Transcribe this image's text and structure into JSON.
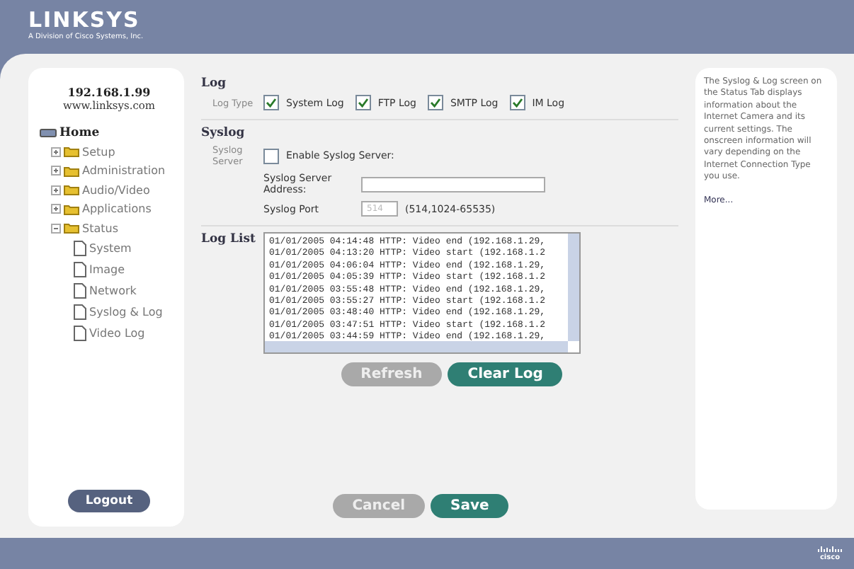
{
  "header": {
    "logo": "LINKSYS",
    "tagline": "A Division of Cisco Systems, Inc."
  },
  "sidebar": {
    "address": "192.168.1.99",
    "site": "www.linksys.com",
    "tree": [
      {
        "label": "Home",
        "children": [
          {
            "label": "Setup",
            "expanded": false
          },
          {
            "label": "Administration",
            "expanded": false
          },
          {
            "label": "Audio/Video",
            "expanded": false
          },
          {
            "label": "Applications",
            "expanded": false
          },
          {
            "label": "Status",
            "expanded": true,
            "children": [
              {
                "label": "System"
              },
              {
                "label": "Image"
              },
              {
                "label": "Network"
              },
              {
                "label": "Syslog & Log"
              },
              {
                "label": "Video Log"
              }
            ]
          }
        ]
      }
    ],
    "logout": "Logout"
  },
  "log": {
    "heading": "Log",
    "label": "Log Type",
    "types": [
      {
        "label": "System Log",
        "checked": true
      },
      {
        "label": "FTP Log",
        "checked": true
      },
      {
        "label": "SMTP Log",
        "checked": true
      },
      {
        "label": "IM Log",
        "checked": true
      }
    ]
  },
  "syslog": {
    "heading": "Syslog",
    "label": "Syslog Server",
    "enable": {
      "label": "Enable Syslog Server:",
      "checked": false
    },
    "address_label": "Syslog Server Address:",
    "port_label": "Syslog Port",
    "port_value": "514",
    "port_disabled": true,
    "port_range": "(514,1024-65535)"
  },
  "log_list": {
    "heading": "Log List",
    "lines": [
      "01/01/2005 04:14:48 HTTP: Video end (192.168.1.29,",
      "01/01/2005 04:13:20 HTTP: Video start (192.168.1.2",
      "01/01/2005 04:06:04 HTTP: Video end (192.168.1.29,",
      "01/01/2005 04:05:39 HTTP: Video start (192.168.1.2",
      "01/01/2005 03:55:48 HTTP: Video end (192.168.1.29,",
      "01/01/2005 03:55:27 HTTP: Video start (192.168.1.2",
      "01/01/2005 03:48:40 HTTP: Video end (192.168.1.29,",
      "01/01/2005 03:47:51 HTTP: Video start (192.168.1.2",
      "01/01/2005 03:44:59 HTTP: Video end (192.168.1.29,"
    ],
    "buttons": [
      {
        "label": "Refresh",
        "kind": "secondary"
      },
      {
        "label": "Clear Log",
        "kind": "primary"
      }
    ]
  },
  "footer_buttons": [
    {
      "label": "Cancel",
      "kind": "secondary"
    },
    {
      "label": "Save",
      "kind": "primary"
    }
  ],
  "help": {
    "text": "The Syslog & Log screen on the Status Tab displays information about the Internet Camera and its current settings. The onscreen information will vary depending on the Internet Connection Type you use.",
    "link": "More..."
  },
  "footer": {
    "logo": "cisco"
  }
}
